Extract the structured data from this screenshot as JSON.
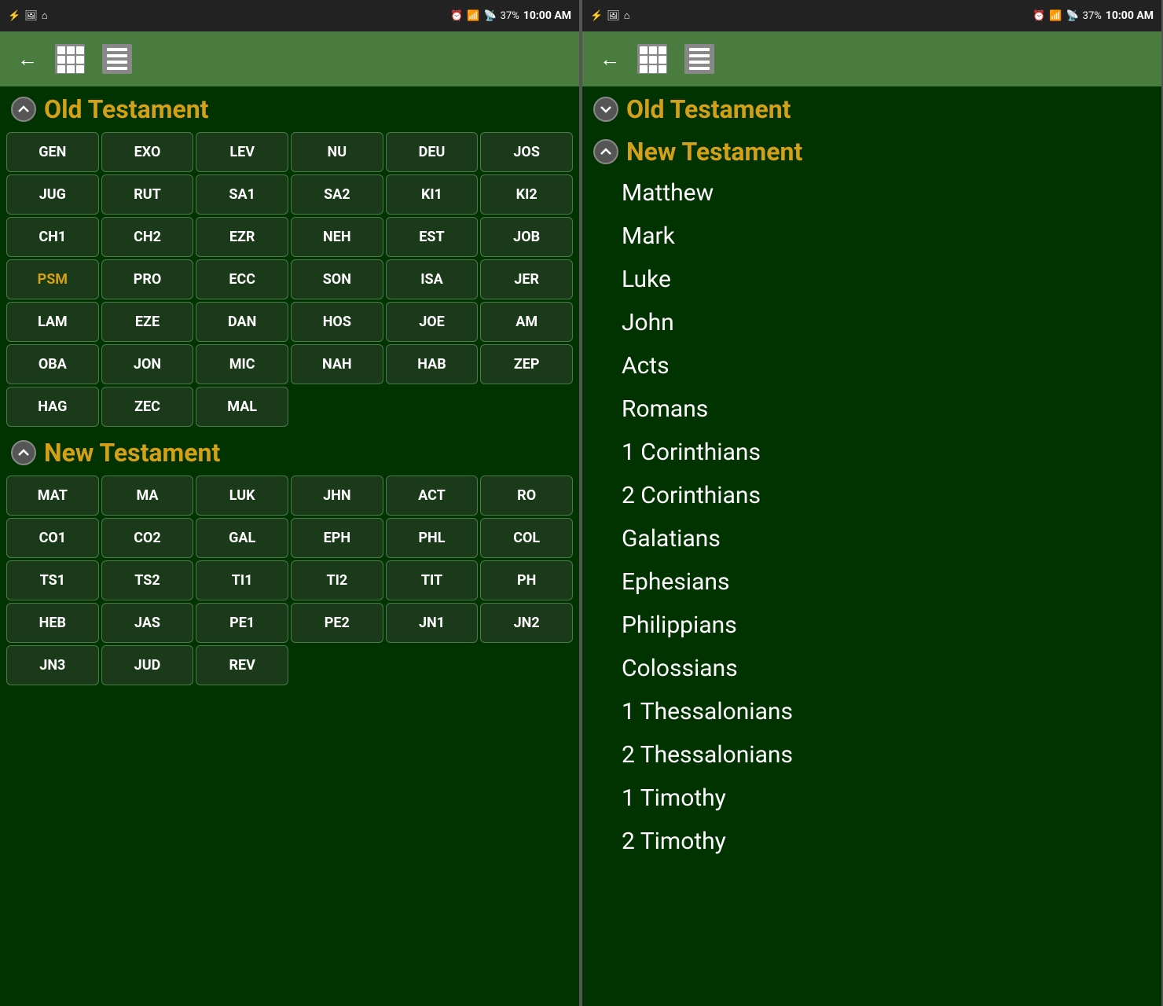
{
  "statusBar": {
    "leftIcons": [
      "usb-icon",
      "image-icon",
      "home-icon"
    ],
    "rightIcons": [
      "alarm-icon",
      "wifi-icon",
      "signal-icon",
      "battery-icon"
    ],
    "battery": "37%",
    "time": "10:00 AM"
  },
  "leftPanel": {
    "toolbar": {
      "backLabel": "←",
      "gridViewLabel": "Grid",
      "listViewLabel": "List"
    },
    "oldTestament": {
      "title": "Old Testament",
      "collapsed": false,
      "books": [
        "GEN",
        "EXO",
        "LEV",
        "NU",
        "DEU",
        "JOS",
        "JUG",
        "RUT",
        "SA1",
        "SA2",
        "KI1",
        "KI2",
        "CH1",
        "CH2",
        "EZR",
        "NEH",
        "EST",
        "JOB",
        "PSM",
        "PRO",
        "ECC",
        "SON",
        "ISA",
        "JER",
        "LAM",
        "EZE",
        "DAN",
        "HOS",
        "JOE",
        "AM",
        "OBA",
        "JON",
        "MIC",
        "NAH",
        "HAB",
        "ZEP",
        "HAG",
        "ZEC",
        "MAL"
      ],
      "activeBook": "PSM"
    },
    "newTestament": {
      "title": "New Testament",
      "collapsed": false,
      "books": [
        "MAT",
        "MA",
        "LUK",
        "JHN",
        "ACT",
        "RO",
        "CO1",
        "CO2",
        "GAL",
        "EPH",
        "PHL",
        "COL",
        "TS1",
        "TS2",
        "TI1",
        "TI2",
        "TIT",
        "PH",
        "HEB",
        "JAS",
        "PE1",
        "PE2",
        "JN1",
        "JN2",
        "JN3",
        "JUD",
        "REV"
      ],
      "activeBook": null
    }
  },
  "rightPanel": {
    "toolbar": {
      "backLabel": "←",
      "gridViewLabel": "Grid",
      "listViewLabel": "List"
    },
    "oldTestament": {
      "title": "Old Testament",
      "collapsed": true
    },
    "newTestament": {
      "title": "New Testament",
      "collapsed": false,
      "books": [
        "Matthew",
        "Mark",
        "Luke",
        "John",
        "Acts",
        "Romans",
        "1 Corinthians",
        "2 Corinthians",
        "Galatians",
        "Ephesians",
        "Philippians",
        "Colossians",
        "1 Thessalonians",
        "2 Thessalonians",
        "1 Timothy",
        "2 Timothy"
      ]
    }
  }
}
